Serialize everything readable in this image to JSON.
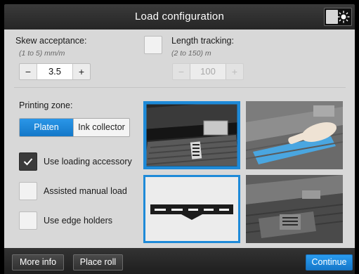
{
  "header": {
    "title": "Load configuration"
  },
  "skew": {
    "label": "Skew acceptance:",
    "range": "(1 to 5) mm/m",
    "value": "3.5",
    "minus": "−",
    "plus": "+"
  },
  "length_tracking": {
    "label": "Length tracking:",
    "range": "(2 to 150) m",
    "value": "100",
    "minus": "−",
    "plus": "+",
    "checked": false,
    "enabled": false
  },
  "printing_zone": {
    "label": "Printing zone:",
    "options": [
      "Platen",
      "Ink collector"
    ],
    "selected": "Platen"
  },
  "options": [
    {
      "label": "Use loading accessory",
      "checked": true
    },
    {
      "label": "Assisted manual load",
      "checked": false
    },
    {
      "label": "Use edge holders",
      "checked": false
    }
  ],
  "footer": {
    "more_info": "More info",
    "place_roll": "Place roll",
    "continue": "Continue"
  },
  "colors": {
    "accent": "#1e8ad8",
    "background": "#d8d8d8",
    "titlebar": "#2f2f2f"
  },
  "icons": {
    "brightness": "sun-icon",
    "check": "checkmark-icon"
  }
}
